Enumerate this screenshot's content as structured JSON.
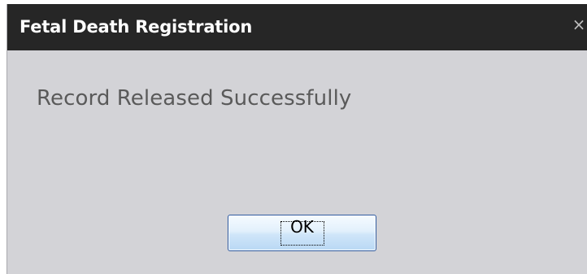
{
  "dialog": {
    "title": "Fetal Death Registration",
    "close_icon": "×",
    "message": "Record Released Successfully",
    "ok_label": "OK"
  },
  "colors": {
    "titlebar": "#262626",
    "body": "#d3d3d7",
    "title_text": "#ffffff",
    "message_text": "#5a5a5a",
    "button_border": "#2d5aa0"
  }
}
